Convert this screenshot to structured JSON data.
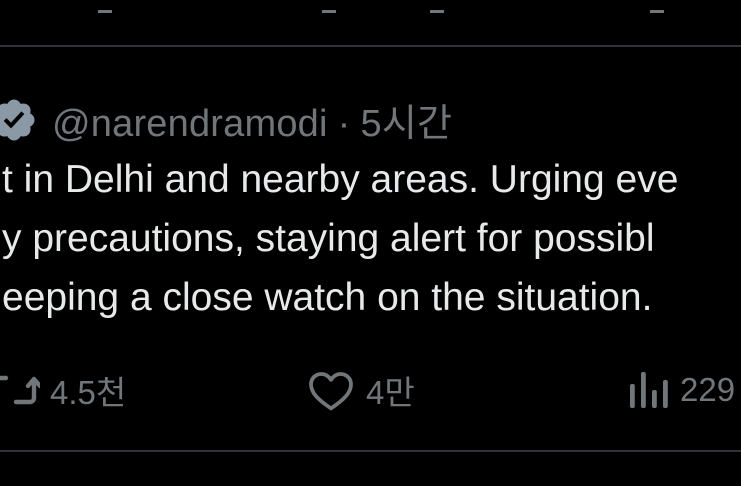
{
  "colors": {
    "background": "#000000",
    "text_primary": "#e7e9ea",
    "text_secondary": "#71767b",
    "divider": "#2f3336",
    "verified_badge": "#8b98a5"
  },
  "tweet": {
    "handle": "@narendramodi",
    "separator": "·",
    "time_ago": "5시간",
    "text_lines": [
      "t in Delhi and nearby areas. Urging eve",
      "y precautions, staying alert for possibl",
      "eeping a close watch on the situation."
    ],
    "verified_icon": "verified-badge-icon"
  },
  "actions": {
    "retweet": {
      "icon": "retweet-icon",
      "count": "4.5천"
    },
    "like": {
      "icon": "heart-icon",
      "count": "4만"
    },
    "views": {
      "icon": "views-chart-icon",
      "count": "229"
    }
  }
}
